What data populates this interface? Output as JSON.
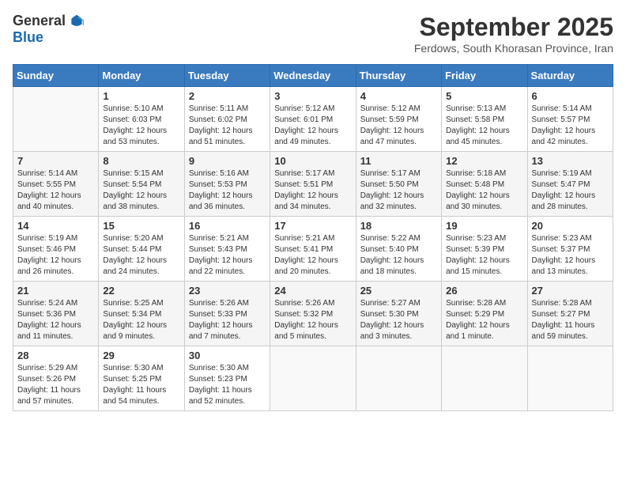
{
  "header": {
    "logo_general": "General",
    "logo_blue": "Blue",
    "month_title": "September 2025",
    "subtitle": "Ferdows, South Khorasan Province, Iran"
  },
  "weekdays": [
    "Sunday",
    "Monday",
    "Tuesday",
    "Wednesday",
    "Thursday",
    "Friday",
    "Saturday"
  ],
  "weeks": [
    [
      {
        "day": "",
        "info": ""
      },
      {
        "day": "1",
        "info": "Sunrise: 5:10 AM\nSunset: 6:03 PM\nDaylight: 12 hours\nand 53 minutes."
      },
      {
        "day": "2",
        "info": "Sunrise: 5:11 AM\nSunset: 6:02 PM\nDaylight: 12 hours\nand 51 minutes."
      },
      {
        "day": "3",
        "info": "Sunrise: 5:12 AM\nSunset: 6:01 PM\nDaylight: 12 hours\nand 49 minutes."
      },
      {
        "day": "4",
        "info": "Sunrise: 5:12 AM\nSunset: 5:59 PM\nDaylight: 12 hours\nand 47 minutes."
      },
      {
        "day": "5",
        "info": "Sunrise: 5:13 AM\nSunset: 5:58 PM\nDaylight: 12 hours\nand 45 minutes."
      },
      {
        "day": "6",
        "info": "Sunrise: 5:14 AM\nSunset: 5:57 PM\nDaylight: 12 hours\nand 42 minutes."
      }
    ],
    [
      {
        "day": "7",
        "info": "Sunrise: 5:14 AM\nSunset: 5:55 PM\nDaylight: 12 hours\nand 40 minutes."
      },
      {
        "day": "8",
        "info": "Sunrise: 5:15 AM\nSunset: 5:54 PM\nDaylight: 12 hours\nand 38 minutes."
      },
      {
        "day": "9",
        "info": "Sunrise: 5:16 AM\nSunset: 5:53 PM\nDaylight: 12 hours\nand 36 minutes."
      },
      {
        "day": "10",
        "info": "Sunrise: 5:17 AM\nSunset: 5:51 PM\nDaylight: 12 hours\nand 34 minutes."
      },
      {
        "day": "11",
        "info": "Sunrise: 5:17 AM\nSunset: 5:50 PM\nDaylight: 12 hours\nand 32 minutes."
      },
      {
        "day": "12",
        "info": "Sunrise: 5:18 AM\nSunset: 5:48 PM\nDaylight: 12 hours\nand 30 minutes."
      },
      {
        "day": "13",
        "info": "Sunrise: 5:19 AM\nSunset: 5:47 PM\nDaylight: 12 hours\nand 28 minutes."
      }
    ],
    [
      {
        "day": "14",
        "info": "Sunrise: 5:19 AM\nSunset: 5:46 PM\nDaylight: 12 hours\nand 26 minutes."
      },
      {
        "day": "15",
        "info": "Sunrise: 5:20 AM\nSunset: 5:44 PM\nDaylight: 12 hours\nand 24 minutes."
      },
      {
        "day": "16",
        "info": "Sunrise: 5:21 AM\nSunset: 5:43 PM\nDaylight: 12 hours\nand 22 minutes."
      },
      {
        "day": "17",
        "info": "Sunrise: 5:21 AM\nSunset: 5:41 PM\nDaylight: 12 hours\nand 20 minutes."
      },
      {
        "day": "18",
        "info": "Sunrise: 5:22 AM\nSunset: 5:40 PM\nDaylight: 12 hours\nand 18 minutes."
      },
      {
        "day": "19",
        "info": "Sunrise: 5:23 AM\nSunset: 5:39 PM\nDaylight: 12 hours\nand 15 minutes."
      },
      {
        "day": "20",
        "info": "Sunrise: 5:23 AM\nSunset: 5:37 PM\nDaylight: 12 hours\nand 13 minutes."
      }
    ],
    [
      {
        "day": "21",
        "info": "Sunrise: 5:24 AM\nSunset: 5:36 PM\nDaylight: 12 hours\nand 11 minutes."
      },
      {
        "day": "22",
        "info": "Sunrise: 5:25 AM\nSunset: 5:34 PM\nDaylight: 12 hours\nand 9 minutes."
      },
      {
        "day": "23",
        "info": "Sunrise: 5:26 AM\nSunset: 5:33 PM\nDaylight: 12 hours\nand 7 minutes."
      },
      {
        "day": "24",
        "info": "Sunrise: 5:26 AM\nSunset: 5:32 PM\nDaylight: 12 hours\nand 5 minutes."
      },
      {
        "day": "25",
        "info": "Sunrise: 5:27 AM\nSunset: 5:30 PM\nDaylight: 12 hours\nand 3 minutes."
      },
      {
        "day": "26",
        "info": "Sunrise: 5:28 AM\nSunset: 5:29 PM\nDaylight: 12 hours\nand 1 minute."
      },
      {
        "day": "27",
        "info": "Sunrise: 5:28 AM\nSunset: 5:27 PM\nDaylight: 11 hours\nand 59 minutes."
      }
    ],
    [
      {
        "day": "28",
        "info": "Sunrise: 5:29 AM\nSunset: 5:26 PM\nDaylight: 11 hours\nand 57 minutes."
      },
      {
        "day": "29",
        "info": "Sunrise: 5:30 AM\nSunset: 5:25 PM\nDaylight: 11 hours\nand 54 minutes."
      },
      {
        "day": "30",
        "info": "Sunrise: 5:30 AM\nSunset: 5:23 PM\nDaylight: 11 hours\nand 52 minutes."
      },
      {
        "day": "",
        "info": ""
      },
      {
        "day": "",
        "info": ""
      },
      {
        "day": "",
        "info": ""
      },
      {
        "day": "",
        "info": ""
      }
    ]
  ]
}
